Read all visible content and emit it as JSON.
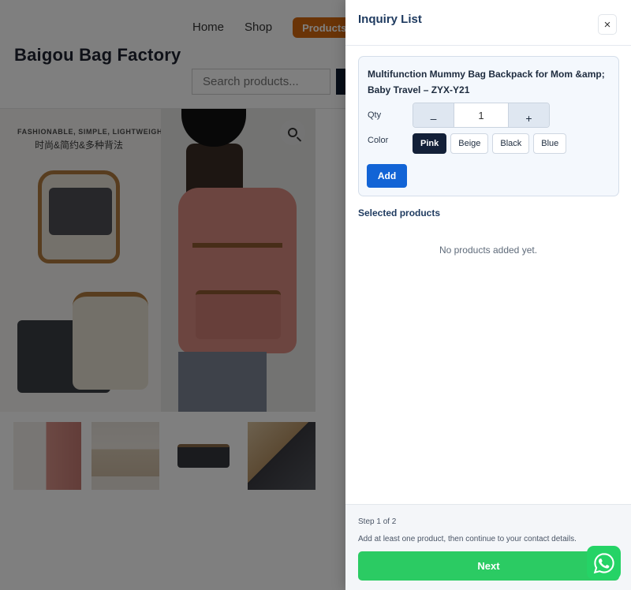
{
  "header": {
    "nav": [
      "Home",
      "Shop"
    ],
    "products_label": "Products",
    "site_title": "Baigou Bag Factory",
    "search_placeholder": "Search products..."
  },
  "gallery": {
    "caption_en": "FASHIONABLE, SIMPLE, LIGHTWEIGHT",
    "caption_zh": "时尚&简约&多种背法"
  },
  "drawer": {
    "title": "Inquiry List",
    "close_label": "×",
    "product_title": "Multifunction Mummy Bag Backpack for Mom &amp; Baby Travel – ZYX-Y21",
    "qty_label": "Qty",
    "qty_minus": "–",
    "qty_value": "1",
    "qty_plus": "+",
    "color_label": "Color",
    "colors": [
      "Pink",
      "Beige",
      "Black",
      "Blue"
    ],
    "selected_color": "Pink",
    "add_label": "Add",
    "selected_title": "Selected products",
    "empty_message": "No products added yet.",
    "step_text": "Step 1 of 2",
    "hint": "Add at least one product, then continue to your contact details.",
    "next_label": "Next"
  },
  "colors": {
    "accent_orange": "#d4690f",
    "primary_blue": "#1264d6",
    "next_green": "#2bcb63",
    "whatsapp_green": "#25d366"
  },
  "icons": {
    "zoom": "magnifier-icon",
    "close": "close-icon",
    "chat": "whatsapp-icon"
  }
}
